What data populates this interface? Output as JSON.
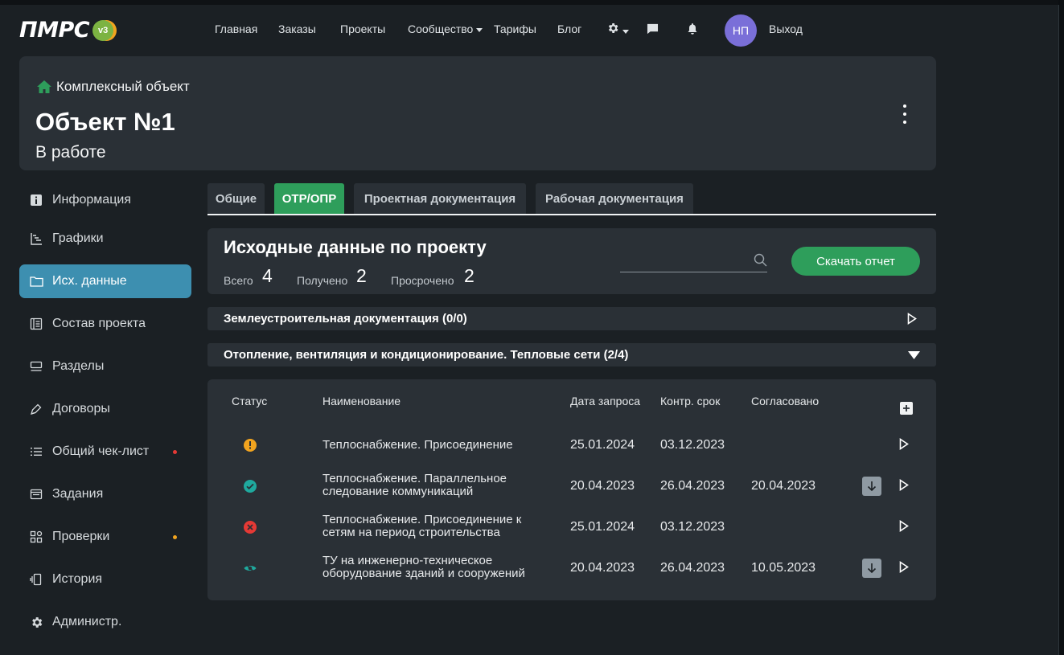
{
  "app": {
    "logo_text": "ПМРС",
    "logo_version": "v3"
  },
  "nav": {
    "items": [
      "Главная",
      "Заказы",
      "Проекты",
      "Сообщество",
      "Тарифы",
      "Блог"
    ],
    "avatar_initials": "НП",
    "logout": "Выход"
  },
  "header": {
    "breadcrumb": "Комплексный объект",
    "title": "Объект №1",
    "status": "В работе"
  },
  "sidebar": {
    "items": [
      {
        "label": "Информация",
        "icon": "info-icon"
      },
      {
        "label": "Графики",
        "icon": "gantt-icon"
      },
      {
        "label": "Исх. данные",
        "icon": "folder-icon",
        "active": true
      },
      {
        "label": "Состав проекта",
        "icon": "book-icon"
      },
      {
        "label": "Разделы",
        "icon": "sections-icon"
      },
      {
        "label": "Договоры",
        "icon": "pen-icon"
      },
      {
        "label": "Общий чек-лист",
        "icon": "list-icon",
        "dot": "#e53935"
      },
      {
        "label": "Задания",
        "icon": "window-icon"
      },
      {
        "label": "Проверки",
        "icon": "grid-icon",
        "dot": "#f2a41f"
      },
      {
        "label": "История",
        "icon": "history-icon"
      },
      {
        "label": "Администр.",
        "icon": "gear-icon"
      }
    ]
  },
  "tabs": [
    "Общие",
    "ОТР/ОПР",
    "Проектная документация",
    "Рабочая документация"
  ],
  "panel": {
    "title": "Исходные данные по проекту",
    "stats": [
      {
        "label": "Всего",
        "value": "4"
      },
      {
        "label": "Получено",
        "value": "2"
      },
      {
        "label": "Просрочено",
        "value": "2"
      }
    ],
    "search_placeholder": "",
    "download_label": "Скачать отчет"
  },
  "accordions": [
    {
      "title": "Землеустроительная документация (0/0)",
      "expanded": false
    },
    {
      "title": "Отопление, вентиляция и кондиционирование. Тепловые сети (2/4)",
      "expanded": true
    }
  ],
  "table": {
    "headers": [
      "Статус",
      "Наименование",
      "Дата запроса",
      "Контр. срок",
      "Согласовано"
    ],
    "rows": [
      {
        "status": "warning",
        "name": "Теплоснабжение. Присоединение",
        "requested": "25.01.2024",
        "deadline": "03.12.2023",
        "approved": "",
        "download": false
      },
      {
        "status": "done",
        "name": "Теплоснабжение. Параллельное следование коммуникаций",
        "requested": "20.04.2023",
        "deadline": "26.04.2023",
        "approved": "20.04.2023",
        "download": true
      },
      {
        "status": "error",
        "name": "Теплоснабжение. Присоединение к сетям на период строительства",
        "requested": "25.01.2024",
        "deadline": "03.12.2023",
        "approved": "",
        "download": false
      },
      {
        "status": "hidden",
        "name": "ТУ на инженерно-техническое оборудование зданий и сооружений",
        "requested": "20.04.2023",
        "deadline": "26.04.2023",
        "approved": "10.05.2023",
        "download": true
      }
    ]
  },
  "colors": {
    "accent": "#2e9e5b",
    "active_sidebar": "#3d8fb0",
    "warning": "#f2a41f",
    "error": "#e53935",
    "success": "#1fa99e"
  }
}
